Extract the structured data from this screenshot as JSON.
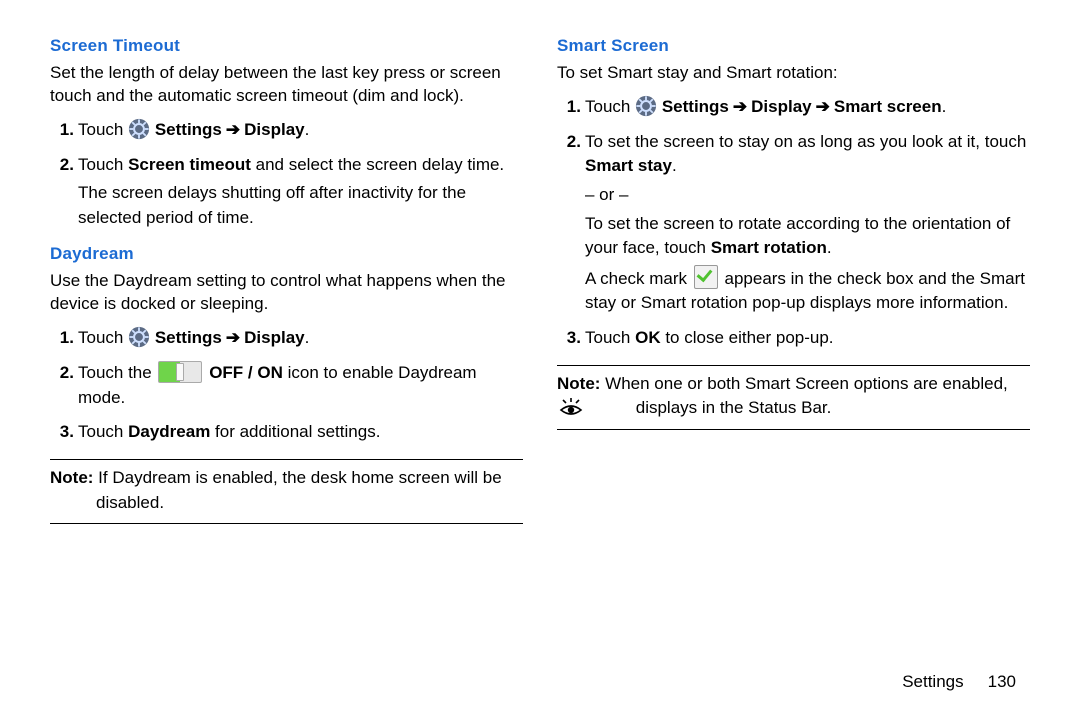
{
  "left": {
    "screen_timeout": {
      "heading": "Screen Timeout",
      "intro": "Set the length of delay between the last key press or screen touch and the automatic screen timeout (dim and lock).",
      "step1_pre": "Touch ",
      "step1_b1": "Settings",
      "arrow": "➔",
      "step1_b2": "Display",
      "step1_post": ".",
      "step2_pre": "Touch ",
      "step2_b1": "Screen timeout",
      "step2_post": " and select the screen delay time.",
      "step2_cont": "The screen delays shutting off after inactivity for the selected period of time."
    },
    "daydream": {
      "heading": "Daydream",
      "intro": "Use the Daydream setting to control what happens when the device is docked or sleeping.",
      "step1_pre": "Touch ",
      "step1_b1": "Settings",
      "arrow": "➔",
      "step1_b2": "Display",
      "step1_post": ".",
      "step2_pre": "Touch the ",
      "step2_b1": "OFF / ON",
      "step2_post": " icon to enable Daydream mode.",
      "step3_pre": "Touch ",
      "step3_b1": "Daydream",
      "step3_post": " for additional settings.",
      "note_label": "Note:",
      "note_body": " If Daydream is enabled, the desk home screen will be disabled."
    }
  },
  "right": {
    "smart_screen": {
      "heading": "Smart Screen",
      "intro": "To set Smart stay and Smart rotation:",
      "step1_pre": "Touch ",
      "step1_b1": "Settings",
      "arrow": "➔",
      "step1_b2": "Display",
      "step1_b3": "Smart screen",
      "step1_post": ".",
      "step2_pre": "To set the screen to stay on as long as you look at it, touch ",
      "step2_b1": "Smart stay",
      "step2_post": ".",
      "or": "– or –",
      "step2_alt_pre": "To set the screen to rotate according to the orientation of your face, touch ",
      "step2_alt_b1": "Smart rotation",
      "step2_alt_post": ".",
      "step2_check_pre": "A check mark ",
      "step2_check_post": " appears in the check box and the Smart stay or Smart rotation pop-up displays more information.",
      "step3_pre": "Touch ",
      "step3_b1": "OK",
      "step3_post": " to close either pop-up.",
      "note_label": "Note:",
      "note_body1": " When one or both Smart Screen options are enabled, ",
      "note_body2": " displays in the Status Bar."
    }
  },
  "footer": {
    "chapter": "Settings",
    "page": "130"
  }
}
